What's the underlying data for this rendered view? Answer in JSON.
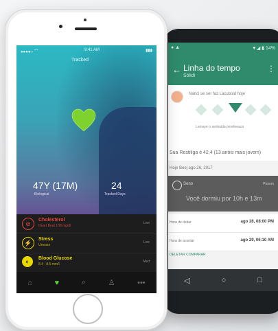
{
  "android": {
    "status_left": "● ▲",
    "status_right": "▼◢ ▮ 14%",
    "back_icon": "back-arrow",
    "title": "Linha do tempo",
    "subtitle": "Sólidi",
    "card_text": "Nanci se ser faz Lacuboid hoje",
    "card_note": "Lemaye o senhuida perefeeaca",
    "goal_text": "Sua Restiliga é 42,4 (13 anóis mais jovem)",
    "date_label": "Hoje Beej ago 26, 2017",
    "dark_title": "Sono",
    "dark_time": "Piroom",
    "dark_main": "Você dormiu por 10h e 13m",
    "rows": [
      {
        "label": "Hora de deitar",
        "value": "ago 28, 08:00 PM"
      },
      {
        "label": "Hora de acordar",
        "value": "ago 29, 06:10 AM"
      }
    ],
    "row_link": "DELETAR   COMPARAR",
    "nav_icons": [
      "◁",
      "○",
      "□"
    ]
  },
  "iphone": {
    "status_left": "●●●●○ ⌒",
    "status_center": "9:41 AM",
    "status_right": "▮▮▮",
    "top_label": "Tracked",
    "age_value": "47Y (17M)",
    "age_label": "Biological",
    "days_value": "24",
    "days_label": "Tracked Days",
    "items": [
      {
        "icon": "⊘",
        "name": "Cholesterol",
        "sub": "Heart Beat 108 mg/dl",
        "value": "Low",
        "color": "#e5453a"
      },
      {
        "icon": "⚡",
        "name": "Stress",
        "sub": "Unease",
        "value": "Low",
        "color": "#e8d800"
      },
      {
        "icon": "◐",
        "name": "Blood Glucose",
        "sub": "8.4 - 8.5 mm/l",
        "value": "Med",
        "color": "#e8d800"
      }
    ],
    "tabs": [
      "⌂",
      "♥",
      "⌕",
      "♙",
      "•••"
    ],
    "accent_green": "#5fd13c"
  }
}
